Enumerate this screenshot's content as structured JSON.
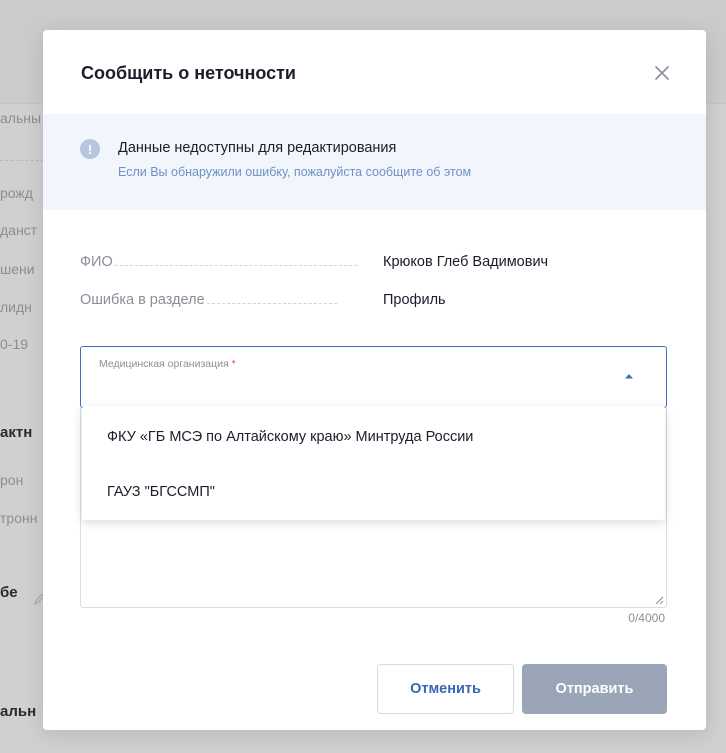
{
  "background": {
    "fragments": [
      {
        "text": "альны"
      },
      {
        "text": "рожд"
      },
      {
        "text": "данст"
      },
      {
        "text": "шени"
      },
      {
        "text": "лидн"
      },
      {
        "text": "0-19"
      },
      {
        "text": "актн"
      },
      {
        "text": "рон"
      },
      {
        "text": "тронн"
      },
      {
        "text": "бе"
      },
      {
        "text": "альн"
      }
    ],
    "pen_icon": "pencil-icon"
  },
  "modal": {
    "title": "Сообщить о неточности",
    "close_icon": "close-icon",
    "notice": {
      "icon": "exclamation-circle-icon",
      "icon_glyph": "!",
      "title": "Данные недоступны для редактирования",
      "subtitle": "Если Вы обнаружили ошибку, пожалуйста сообщите об этом"
    },
    "info": [
      {
        "label": "ФИО",
        "value": "Крюков Глеб Вадимович"
      },
      {
        "label": "Ошибка в разделе",
        "value": "Профиль"
      }
    ],
    "select": {
      "label": "Медицинская организация",
      "required_mark": "*",
      "arrow_icon": "caret-up-icon",
      "options": [
        {
          "label": "ФКУ «ГБ МСЭ по Алтайскому краю» Минтруда России"
        },
        {
          "label": "ГАУЗ \"БГССМП\""
        }
      ]
    },
    "textarea": {
      "counter": "0/4000"
    },
    "buttons": {
      "cancel": "Отменить",
      "submit": "Отправить"
    }
  },
  "colors": {
    "accent": "#3f6fc0",
    "notice_bg": "#f2f6fc",
    "notice_sub": "#6f91c4",
    "submit_disabled": "#9aa5b8",
    "required": "#e04b4b"
  }
}
